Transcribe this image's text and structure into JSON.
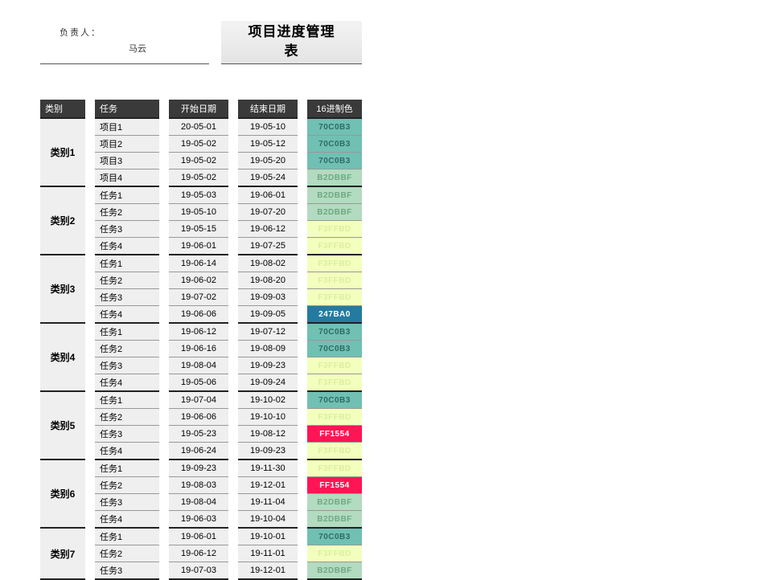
{
  "header": {
    "owner_label": "负责人：",
    "owner_name": "马云",
    "title_line1": "项目进度管理",
    "title_line2": "表"
  },
  "columns": {
    "cat": "类别",
    "task": "任务",
    "start": "开始日期",
    "end": "结束日期",
    "color": "16进制色"
  },
  "colors": {
    "70C0B3": "#70C0B3",
    "B2DBBF": "#B2DBBF",
    "F3FFBD": "#F3FFBD",
    "247BA0": "#247BA0",
    "FF1554": "#FF1554"
  },
  "colorText": {
    "70C0B3": "#2e6b63",
    "B2DBBF": "#6fa884",
    "F3FFBD": "#dceea0",
    "247BA0": "#ffffff",
    "FF1554": "#ffffff"
  },
  "groups": [
    {
      "name": "类别1",
      "rows": [
        {
          "task": "项目1",
          "start": "20-05-01",
          "end": "19-05-10",
          "color": "70C0B3"
        },
        {
          "task": "项目2",
          "start": "19-05-02",
          "end": "19-05-12",
          "color": "70C0B3"
        },
        {
          "task": "项目3",
          "start": "19-05-02",
          "end": "19-05-20",
          "color": "70C0B3"
        },
        {
          "task": "项目4",
          "start": "19-05-02",
          "end": "19-05-24",
          "color": "B2DBBF"
        }
      ]
    },
    {
      "name": "类别2",
      "rows": [
        {
          "task": "任务1",
          "start": "19-05-03",
          "end": "19-06-01",
          "color": "B2DBBF"
        },
        {
          "task": "任务2",
          "start": "19-05-10",
          "end": "19-07-20",
          "color": "B2DBBF"
        },
        {
          "task": "任务3",
          "start": "19-05-15",
          "end": "19-06-12",
          "color": "F3FFBD"
        },
        {
          "task": "任务4",
          "start": "19-06-01",
          "end": "19-07-25",
          "color": "F3FFBD"
        }
      ]
    },
    {
      "name": "类别3",
      "rows": [
        {
          "task": "任务1",
          "start": "19-06-14",
          "end": "19-08-02",
          "color": "F3FFBD"
        },
        {
          "task": "任务2",
          "start": "19-06-02",
          "end": "19-08-20",
          "color": "F3FFBD"
        },
        {
          "task": "任务3",
          "start": "19-07-02",
          "end": "19-09-03",
          "color": "F3FFBD"
        },
        {
          "task": "任务4",
          "start": "19-06-06",
          "end": "19-09-05",
          "color": "247BA0"
        }
      ]
    },
    {
      "name": "类别4",
      "rows": [
        {
          "task": "任务1",
          "start": "19-06-12",
          "end": "19-07-12",
          "color": "70C0B3"
        },
        {
          "task": "任务2",
          "start": "19-06-16",
          "end": "19-08-09",
          "color": "70C0B3"
        },
        {
          "task": "任务3",
          "start": "19-08-04",
          "end": "19-09-23",
          "color": "F3FFBD"
        },
        {
          "task": "任务4",
          "start": "19-05-06",
          "end": "19-09-24",
          "color": "F3FFBD"
        }
      ]
    },
    {
      "name": "类别5",
      "rows": [
        {
          "task": "任务1",
          "start": "19-07-04",
          "end": "19-10-02",
          "color": "70C0B3"
        },
        {
          "task": "任务2",
          "start": "19-06-06",
          "end": "19-10-10",
          "color": "F3FFBD"
        },
        {
          "task": "任务3",
          "start": "19-05-23",
          "end": "19-08-12",
          "color": "FF1554"
        },
        {
          "task": "任务4",
          "start": "19-06-24",
          "end": "19-09-23",
          "color": "F3FFBD"
        }
      ]
    },
    {
      "name": "类别6",
      "rows": [
        {
          "task": "任务1",
          "start": "19-09-23",
          "end": "19-11-30",
          "color": "F3FFBD"
        },
        {
          "task": "任务2",
          "start": "19-08-03",
          "end": "19-12-01",
          "color": "FF1554"
        },
        {
          "task": "任务3",
          "start": "19-08-04",
          "end": "19-11-04",
          "color": "B2DBBF"
        },
        {
          "task": "任务4",
          "start": "19-06-03",
          "end": "19-10-04",
          "color": "B2DBBF"
        }
      ]
    },
    {
      "name": "类别7",
      "rows": [
        {
          "task": "任务1",
          "start": "19-06-01",
          "end": "19-10-01",
          "color": "70C0B3"
        },
        {
          "task": "任务2",
          "start": "19-06-12",
          "end": "19-11-01",
          "color": "F3FFBD"
        },
        {
          "task": "任务3",
          "start": "19-07-03",
          "end": "19-12-01",
          "color": "B2DBBF"
        }
      ]
    }
  ]
}
